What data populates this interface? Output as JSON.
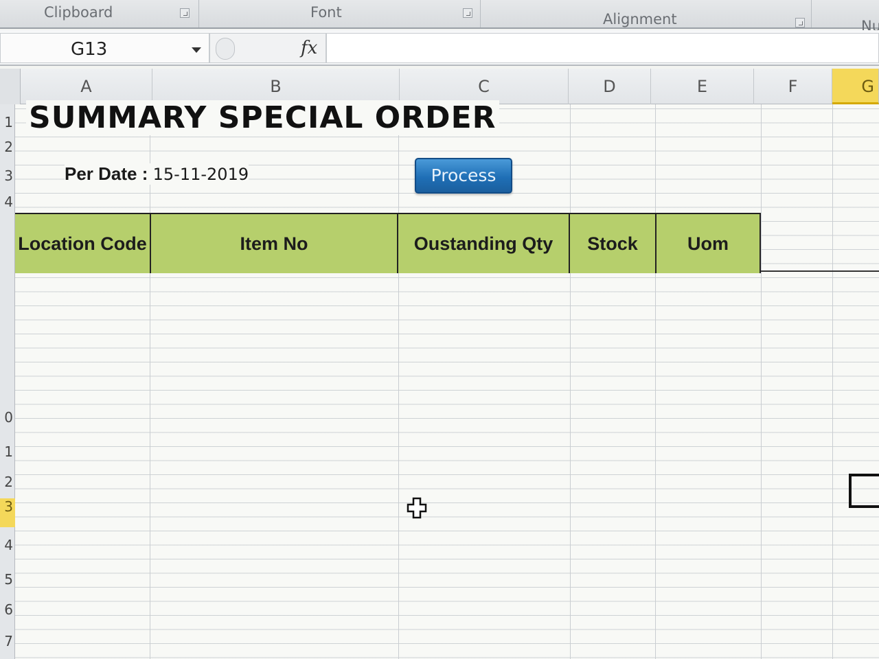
{
  "ribbon": {
    "groups": [
      {
        "label": "Clipboard"
      },
      {
        "label": "Font"
      },
      {
        "label": "Alignment"
      },
      {
        "label": "Nu"
      }
    ]
  },
  "formula_bar": {
    "name_box": "G13",
    "fx_label": "fx",
    "formula_value": ""
  },
  "columns": [
    "A",
    "B",
    "C",
    "D",
    "E",
    "F",
    "G"
  ],
  "selected_column": "G",
  "rows": [
    "1",
    "2",
    "3",
    "4",
    "0",
    "1",
    "2",
    "3",
    "4",
    "5",
    "6",
    "7"
  ],
  "selected_row": "3",
  "sheet": {
    "title": "SUMMARY SPECIAL ORDER",
    "per_date_label": "Per Date :",
    "per_date_value": "15-11-2019",
    "process_button": "Process",
    "table_headers": [
      "Location Code",
      "Item No",
      "Oustanding Qty",
      "Stock",
      "Uom"
    ]
  },
  "colors": {
    "header_fill": "#b6cf6c",
    "button_blue": "#1f6fb6",
    "selection_yellow": "#f4d85a"
  }
}
